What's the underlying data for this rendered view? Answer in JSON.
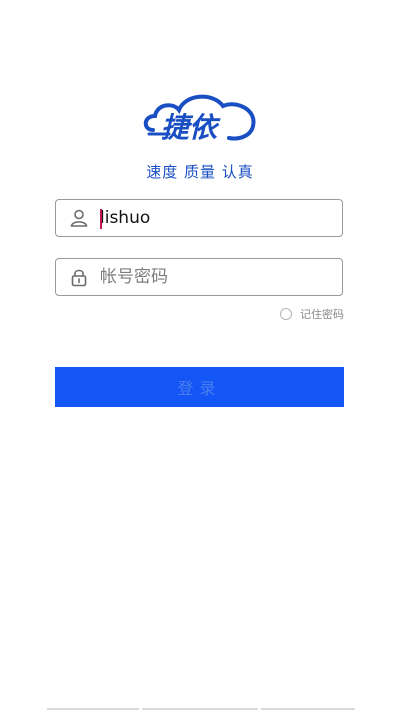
{
  "app": {
    "logo_text": "捷依",
    "slogan": "速度 质量 认真"
  },
  "login": {
    "username": {
      "value": "lishuo",
      "icon": "user-icon"
    },
    "password": {
      "placeholder": "帐号密码",
      "icon": "lock-icon"
    },
    "remember_label": "记住密码",
    "remember_checked": false,
    "login_button_label": "登录"
  },
  "colors": {
    "brand_blue": "#1a4fc4",
    "button_blue": "#1355f5"
  }
}
